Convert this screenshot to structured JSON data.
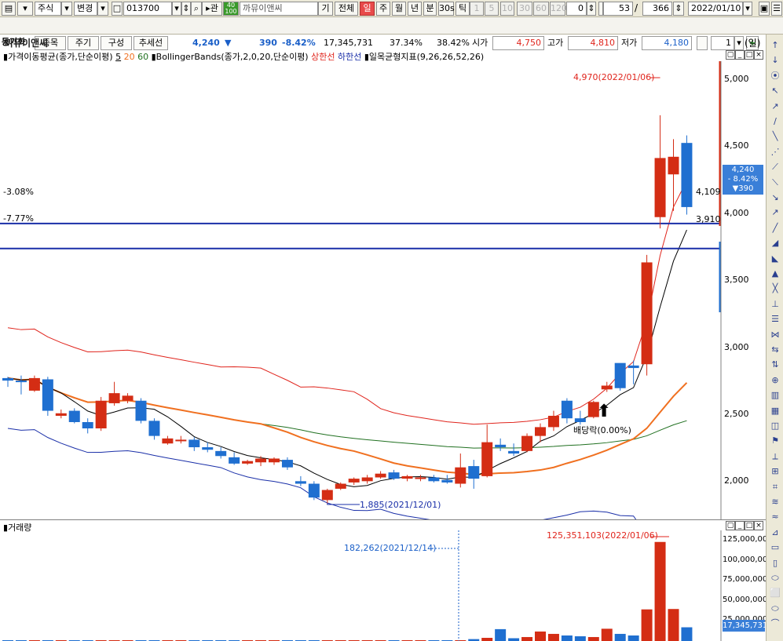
{
  "toolbar": {
    "type_select": "주식",
    "change_btn": "변경",
    "code": "013700",
    "related_btn": "관",
    "name": "까뮤이앤씨",
    "period_buttons": [
      "기",
      "전체",
      "일",
      "주",
      "월",
      "년",
      "분",
      "30s",
      "틱"
    ],
    "selected_period": "일",
    "interval_buttons": [
      "1",
      "5",
      "10",
      "30",
      "60",
      "120"
    ],
    "interval_value": "0",
    "count_value": "53",
    "count_sep": "/",
    "count_total": "366",
    "date": "2022/01/10"
  },
  "toolbar2": {
    "label": "동기화",
    "buttons": [
      "종목",
      "주기",
      "구성",
      "추세선"
    ],
    "price": "4,240",
    "change": "390",
    "change_pct": "-8.42%",
    "volume": "17,345,731",
    "ratio1": "37.34%",
    "ratio2": "38.42%",
    "open_label": "시가",
    "open": "4,750",
    "high_label": "고가",
    "high": "4,810",
    "low_label": "저가",
    "low": "4,180",
    "spin_value": "1"
  },
  "chart": {
    "title": "까뮤이앤씨",
    "period_unit": "(일)",
    "legend": {
      "ma": "가격이동평균(종가,단순이평)",
      "ma5": "5",
      "ma20": "20",
      "ma60": "60",
      "bb": "BollingerBands(종가,2,0,20,단순이평)",
      "bb_upper": "상한선",
      "bb_lower": "하한선",
      "ichimoku": "일목균형지표(9,26,26,52,26)"
    },
    "hline_labels": [
      "-3.08%",
      "-7.77%"
    ],
    "hline_values": [
      "4,109",
      "3,910"
    ],
    "annotation_high": "4,970(2022/01/06)",
    "annotation_low": "1,885(2021/12/01)",
    "annotation_dividend": "배당락(0.00%)",
    "price_tag": {
      "price": "4,240",
      "pct": "- 8.42%",
      "chg": "▼390"
    },
    "y_ticks": [
      "5,000",
      "4,500",
      "4,000",
      "3,500",
      "3,000",
      "2,500",
      "2,000"
    ],
    "volume_title": "거래량",
    "volume_annotation_max": "125,351,103(2022/01/06)",
    "volume_annotation_mark": "182,262(2021/12/14)",
    "volume_y_ticks": [
      "125,000,000",
      "100,000,000",
      "75,000,000",
      "50,000,000",
      "25,000,000"
    ],
    "volume_tag": "17,345,731"
  },
  "chart_data": {
    "type": "candlestick",
    "ylim": [
      1750,
      5400
    ],
    "candles": [
      {
        "o": 2860,
        "h": 2890,
        "l": 2810,
        "c": 2880,
        "up": false
      },
      {
        "o": 2860,
        "h": 2900,
        "l": 2750,
        "c": 2850,
        "up": false
      },
      {
        "o": 2780,
        "h": 2900,
        "l": 2770,
        "c": 2880,
        "up": true
      },
      {
        "o": 2870,
        "h": 2890,
        "l": 2580,
        "c": 2620,
        "up": false
      },
      {
        "o": 2600,
        "h": 2630,
        "l": 2560,
        "c": 2580,
        "up": true
      },
      {
        "o": 2620,
        "h": 2640,
        "l": 2520,
        "c": 2530,
        "up": false
      },
      {
        "o": 2530,
        "h": 2560,
        "l": 2440,
        "c": 2480,
        "up": false
      },
      {
        "o": 2480,
        "h": 2730,
        "l": 2460,
        "c": 2700,
        "up": true
      },
      {
        "o": 2680,
        "h": 2850,
        "l": 2660,
        "c": 2760,
        "up": true
      },
      {
        "o": 2700,
        "h": 2760,
        "l": 2680,
        "c": 2740,
        "up": true
      },
      {
        "o": 2700,
        "h": 2720,
        "l": 2520,
        "c": 2540,
        "up": false
      },
      {
        "o": 2540,
        "h": 2560,
        "l": 2390,
        "c": 2420,
        "up": false
      },
      {
        "o": 2360,
        "h": 2420,
        "l": 2350,
        "c": 2400,
        "up": true
      },
      {
        "o": 2390,
        "h": 2420,
        "l": 2360,
        "c": 2380,
        "up": true
      },
      {
        "o": 2390,
        "h": 2410,
        "l": 2300,
        "c": 2330,
        "up": false
      },
      {
        "o": 2330,
        "h": 2370,
        "l": 2290,
        "c": 2310,
        "up": false
      },
      {
        "o": 2300,
        "h": 2330,
        "l": 2240,
        "c": 2260,
        "up": false
      },
      {
        "o": 2250,
        "h": 2290,
        "l": 2190,
        "c": 2200,
        "up": false
      },
      {
        "o": 2200,
        "h": 2230,
        "l": 2190,
        "c": 2220,
        "up": true
      },
      {
        "o": 2210,
        "h": 2260,
        "l": 2180,
        "c": 2240,
        "up": true
      },
      {
        "o": 2210,
        "h": 2250,
        "l": 2190,
        "c": 2240,
        "up": true
      },
      {
        "o": 2230,
        "h": 2250,
        "l": 2150,
        "c": 2170,
        "up": false
      },
      {
        "o": 2060,
        "h": 2100,
        "l": 2020,
        "c": 2040,
        "up": false
      },
      {
        "o": 2040,
        "h": 2060,
        "l": 1910,
        "c": 1930,
        "up": false
      },
      {
        "o": 1910,
        "h": 2000,
        "l": 1885,
        "c": 1990,
        "up": true
      },
      {
        "o": 2000,
        "h": 2050,
        "l": 1990,
        "c": 2040,
        "up": true
      },
      {
        "o": 2050,
        "h": 2090,
        "l": 2030,
        "c": 2080,
        "up": true
      },
      {
        "o": 2060,
        "h": 2110,
        "l": 2040,
        "c": 2090,
        "up": true
      },
      {
        "o": 2090,
        "h": 2140,
        "l": 2080,
        "c": 2120,
        "up": true
      },
      {
        "o": 2130,
        "h": 2150,
        "l": 2070,
        "c": 2080,
        "up": false
      },
      {
        "o": 2080,
        "h": 2110,
        "l": 2060,
        "c": 2100,
        "up": true
      },
      {
        "o": 2080,
        "h": 2110,
        "l": 2060,
        "c": 2090,
        "up": true
      },
      {
        "o": 2090,
        "h": 2110,
        "l": 2050,
        "c": 2060,
        "up": false
      },
      {
        "o": 2070,
        "h": 2110,
        "l": 2040,
        "c": 2050,
        "up": false
      },
      {
        "o": 2040,
        "h": 2280,
        "l": 2010,
        "c": 2170,
        "up": true
      },
      {
        "o": 2180,
        "h": 2230,
        "l": 2000,
        "c": 2080,
        "up": false
      },
      {
        "o": 2100,
        "h": 2510,
        "l": 2090,
        "c": 2370,
        "up": true
      },
      {
        "o": 2350,
        "h": 2400,
        "l": 2300,
        "c": 2330,
        "up": false
      },
      {
        "o": 2300,
        "h": 2360,
        "l": 2260,
        "c": 2280,
        "up": false
      },
      {
        "o": 2300,
        "h": 2440,
        "l": 2290,
        "c": 2420,
        "up": true
      },
      {
        "o": 2420,
        "h": 2520,
        "l": 2370,
        "c": 2490,
        "up": true
      },
      {
        "o": 2490,
        "h": 2620,
        "l": 2460,
        "c": 2580,
        "up": true
      },
      {
        "o": 2560,
        "h": 2720,
        "l": 2520,
        "c": 2700,
        "up": false
      },
      {
        "o": 2560,
        "h": 2620,
        "l": 2510,
        "c": 2530,
        "up": false
      },
      {
        "o": 2570,
        "h": 2700,
        "l": 2560,
        "c": 2690,
        "up": true
      },
      {
        "o": 2790,
        "h": 2850,
        "l": 2770,
        "c": 2820,
        "up": true
      },
      {
        "o": 2800,
        "h": 2980,
        "l": 2780,
        "c": 3000,
        "up": false
      },
      {
        "o": 2960,
        "h": 3020,
        "l": 2830,
        "c": 2980,
        "up": false
      },
      {
        "o": 2990,
        "h": 3860,
        "l": 2900,
        "c": 3800,
        "up": true
      },
      {
        "o": 4160,
        "h": 4970,
        "l": 4070,
        "c": 4630,
        "up": true
      },
      {
        "o": 4500,
        "h": 4780,
        "l": 4210,
        "c": 4640,
        "up": true
      },
      {
        "o": 4750,
        "h": 4810,
        "l": 4180,
        "c": 4240,
        "up": false
      }
    ],
    "volume": [
      0.3,
      0.2,
      0.3,
      0.2,
      0.2,
      0.2,
      0.3,
      0.4,
      0.3,
      0.3,
      0.2,
      0.3,
      0.2,
      0.2,
      0.3,
      0.2,
      0.2,
      0.3,
      0.2,
      0.2,
      0.2,
      0.3,
      0.4,
      0.3,
      0.3,
      0.2,
      0.2,
      0.2,
      0.2,
      0.2,
      0.2,
      0.2,
      0.2,
      0.2,
      0.2,
      2.4,
      4.0,
      15.0,
      3.5,
      5.0,
      12.0,
      9.0,
      7.0,
      6.0,
      5.0,
      15.5,
      9.0,
      7.0,
      40.0,
      125.35,
      40.5,
      17.35
    ],
    "volume_up": [
      false,
      false,
      true,
      false,
      true,
      false,
      false,
      true,
      true,
      true,
      false,
      false,
      true,
      true,
      false,
      false,
      false,
      false,
      true,
      true,
      true,
      false,
      false,
      false,
      true,
      true,
      true,
      true,
      true,
      false,
      true,
      true,
      false,
      false,
      true,
      false,
      true,
      false,
      false,
      true,
      true,
      true,
      false,
      false,
      true,
      true,
      false,
      false,
      true,
      true,
      true,
      false
    ],
    "volume_ylim": [
      0,
      140
    ]
  }
}
